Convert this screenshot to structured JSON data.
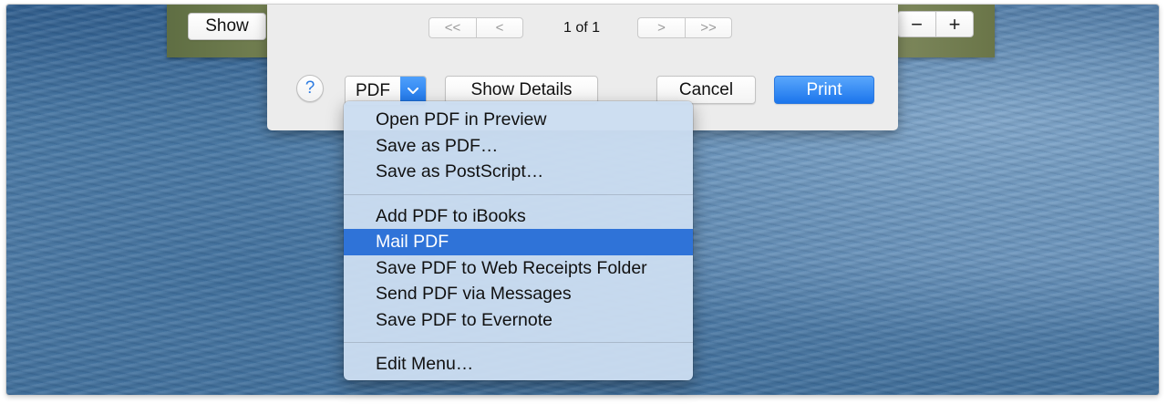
{
  "background": {
    "show_button": "Show",
    "zoom_out": "−",
    "zoom_in": "+"
  },
  "print_dialog": {
    "pager": {
      "first": "<<",
      "previous": "<",
      "page_indicator": "1 of 1",
      "next": ">",
      "last": ">>"
    },
    "help": "?",
    "pdf_button": "PDF",
    "show_details": "Show Details",
    "cancel": "Cancel",
    "print": "Print"
  },
  "pdf_menu": {
    "groups": [
      [
        "Open PDF in Preview",
        "Save as PDF…",
        "Save as PostScript…"
      ],
      [
        "Add PDF to iBooks",
        "Mail PDF",
        "Save PDF to Web Receipts Folder",
        "Send PDF via Messages",
        "Save PDF to Evernote"
      ],
      [
        "Edit Menu…"
      ]
    ],
    "selected": "Mail PDF"
  },
  "colors": {
    "accent_blue": "#2f73d8",
    "menu_background": "#cbddf0",
    "dialog_background": "#ececec"
  },
  "icons": {
    "pdf_dropdown": "chevron-down-icon",
    "help": "question-mark-icon"
  }
}
